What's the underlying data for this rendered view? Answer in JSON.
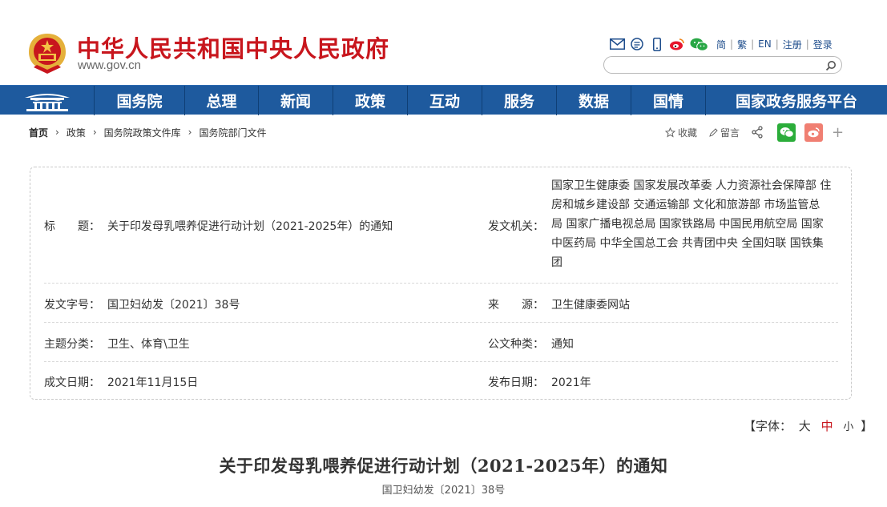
{
  "header": {
    "site_name": "中华人民共和国中央人民政府",
    "site_url": "www.gov.cn",
    "links": [
      "简",
      "繁",
      "EN",
      "注册",
      "登录"
    ],
    "search_placeholder": ""
  },
  "nav": {
    "items": [
      "国务院",
      "总理",
      "新闻",
      "政策",
      "互动",
      "服务",
      "数据",
      "国情",
      "国家政务服务平台"
    ]
  },
  "breadcrumb": [
    "首页",
    "政策",
    "国务院政策文件库",
    "国务院部门文件"
  ],
  "tools": {
    "favorite": "收藏",
    "comment": "留言"
  },
  "info": {
    "title_label": "标　　题：",
    "title_value": "关于印发母乳喂养促进行动计划（2021-2025年）的通知",
    "issuer_label": "发文机关：",
    "issuer_lines": [
      "国家卫生健康委 国家发展改革委 人力资源社会保障部 住",
      "房和城乡建设部 交通运输部 文化和旅游部 市场监管总",
      "局 国家广播电视总局 国家铁路局 中国民用航空局 国家",
      "中医药局 中华全国总工会 共青团中央 全国妇联 国铁集",
      "团"
    ],
    "doc_no_label": "发文字号：",
    "doc_no_value": "国卫妇幼发〔2021〕38号",
    "source_label": "来　　源：",
    "source_value": "卫生健康委网站",
    "topic_label": "主题分类：",
    "topic_value": "卫生、体育\\卫生",
    "type_label": "公文种类：",
    "type_value": "通知",
    "written_label": "成文日期：",
    "written_value": "2021年11月15日",
    "published_label": "发布日期：",
    "published_value": "2021年"
  },
  "font_size": {
    "prefix": "【字体：",
    "large": "大",
    "medium": "中",
    "small": "小",
    "suffix": "】"
  },
  "document": {
    "title": "关于印发母乳喂养促进行动计划（2021-2025年）的通知",
    "number": "国卫妇幼发〔2021〕38号"
  },
  "colors": {
    "brand_red": "#c8161d",
    "nav_blue": "#1e5a9e"
  }
}
